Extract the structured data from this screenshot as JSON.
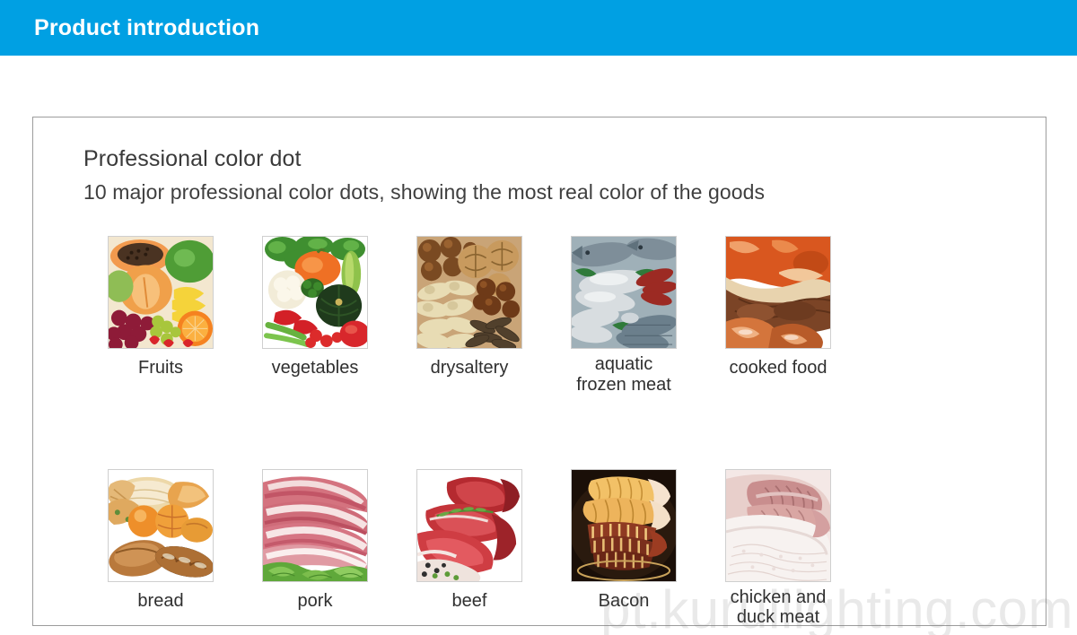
{
  "header": {
    "title": "Product introduction",
    "bar_color": "#00a0e3"
  },
  "panel": {
    "heading": "Professional color dot",
    "subheading": "10 major professional color dots, showing the most real color of the goods",
    "border_color": "#9c9c9c"
  },
  "grid": {
    "row1": [
      {
        "label": "Fruits",
        "image": "fruits-photo"
      },
      {
        "label": "vegetables",
        "image": "vegetables-photo"
      },
      {
        "label": "drysaltery",
        "image": "drysaltery-nuts-photo"
      },
      {
        "label": "aquatic\nfrozen meat",
        "image": "aquatic-frozen-meat-photo"
      },
      {
        "label": "cooked food",
        "image": "cooked-food-photo"
      }
    ],
    "row2": [
      {
        "label": "bread",
        "image": "bread-photo"
      },
      {
        "label": "pork",
        "image": "pork-photo"
      },
      {
        "label": "beef",
        "image": "beef-photo"
      },
      {
        "label": "Bacon",
        "image": "bacon-photo"
      },
      {
        "label": "chicken and\nduck meat",
        "image": "chicken-duck-meat-photo"
      }
    ]
  },
  "watermark": {
    "text": "pt.kuruilighting.com"
  }
}
